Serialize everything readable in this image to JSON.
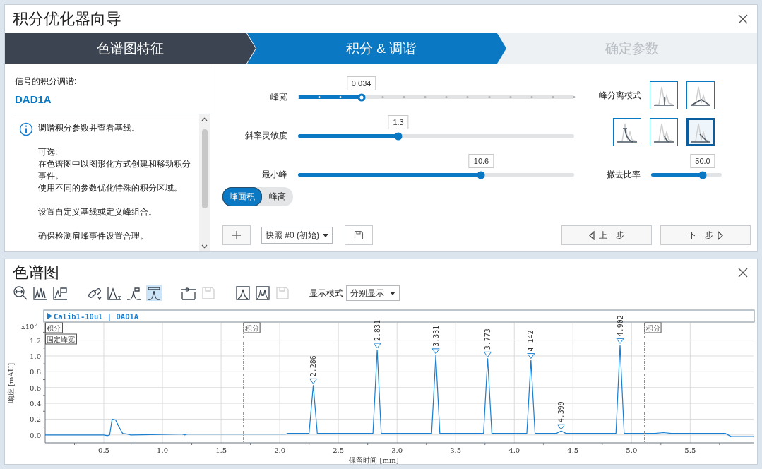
{
  "wizard": {
    "title": "积分优化器向导",
    "steps": [
      {
        "label": "色谱图特征",
        "selected": false,
        "completed": true
      },
      {
        "label": "积分 & 调谐",
        "selected": true,
        "completed": false
      },
      {
        "label": "确定参数",
        "selected": false,
        "completed": false
      }
    ]
  },
  "signal_pane": {
    "heading": "信号的积分调谐:",
    "signal": "DAD1A",
    "info": [
      [
        "调谐积分参数并查看基线。"
      ],
      [
        "可选:",
        "在色谱图中以图形化方式创建和移动积分事件。",
        "使用不同的参数优化特殊的积分区域。"
      ],
      [
        "设置自定义基线或定义峰组合。"
      ],
      [
        "确保检测肩峰事件设置合理。"
      ]
    ]
  },
  "sliders": [
    {
      "label": "峰宽",
      "value": "0.034",
      "level": 0.23,
      "ticks": true
    },
    {
      "label": "斜率灵敏度",
      "value": "1.3",
      "level": 0.364,
      "ticks": false
    },
    {
      "label": "最小峰",
      "value": "10.6",
      "level": 0.664,
      "ticks": false
    }
  ],
  "peak_measure": [
    {
      "label": "峰面积",
      "selected": true
    },
    {
      "label": "峰高",
      "selected": false
    }
  ],
  "separation": {
    "label": "峰分离模式",
    "modes": [
      {
        "kind": "drop",
        "selected": false
      },
      {
        "kind": "valley",
        "selected": false
      },
      {
        "kind": "exp-skim",
        "selected": false
      },
      {
        "kind": "tangent-skim",
        "selected": false
      },
      {
        "kind": "front-skim",
        "selected": true
      }
    ]
  },
  "removal_slider": {
    "label": "撤去比率",
    "value": "50.0",
    "level": 0.73,
    "ticks": false
  },
  "snapshot": {
    "value": "快照 #0 (初始)"
  },
  "nav_buttons": [
    {
      "label": "上一步",
      "kind": "back"
    },
    {
      "label": "下一步",
      "kind": "next"
    }
  ],
  "chromatogram_panel": {
    "title": "色谱图",
    "toolbar": [
      [
        {
          "kind": "zoom",
          "selected": false,
          "disabled": false
        },
        {
          "kind": "peaks",
          "selected": false,
          "disabled": false
        },
        {
          "kind": "step",
          "selected": false,
          "disabled": false
        }
      ],
      [
        {
          "kind": "link",
          "selected": false,
          "disabled": false
        },
        {
          "kind": "peak-axis",
          "selected": false,
          "disabled": false
        },
        {
          "kind": "peak-event",
          "selected": false,
          "disabled": false
        },
        {
          "kind": "peak-box",
          "selected": true,
          "disabled": false
        }
      ],
      [
        {
          "kind": "event-line",
          "selected": false,
          "disabled": false
        },
        {
          "kind": "save",
          "selected": false,
          "disabled": true
        }
      ],
      [
        {
          "kind": "peak-frame",
          "selected": false,
          "disabled": false
        },
        {
          "kind": "peaks-frame",
          "selected": false,
          "disabled": false
        },
        {
          "kind": "save",
          "selected": false,
          "disabled": true
        }
      ]
    ],
    "display_mode": {
      "label": "显示模式",
      "value": "分别显示"
    },
    "y_axis_multiplier": "x10$^{2}$",
    "chart_data": {
      "type": "line",
      "title": "Calib1-10ul | DAD1A",
      "xlabel": "保留时间 [min]",
      "ylabel": "响应 [mAU]",
      "grid": true,
      "xlim": [
        0,
        6.04
      ],
      "ylim": [
        -0.1,
        1.42
      ],
      "xticks": [
        {
          "value": 0.5,
          "label": "0.5"
        },
        {
          "value": 1,
          "label": "1.0"
        },
        {
          "value": 1.5,
          "label": "1.5"
        },
        {
          "value": 2,
          "label": "2.0"
        },
        {
          "value": 2.5,
          "label": "2.5"
        },
        {
          "value": 3,
          "label": "3.0"
        },
        {
          "value": 3.5,
          "label": "3.5"
        },
        {
          "value": 4,
          "label": "4.0"
        },
        {
          "value": 4.5,
          "label": "4.5"
        },
        {
          "value": 5,
          "label": "5.0"
        },
        {
          "value": 5.5,
          "label": "5.5"
        }
      ],
      "yticks": [
        {
          "value": 0,
          "label": "0.0"
        },
        {
          "value": 0.2,
          "label": "0.2"
        },
        {
          "value": 0.4,
          "label": "0.4"
        },
        {
          "value": 0.6,
          "label": "0.6"
        },
        {
          "value": 0.8,
          "label": "0.8"
        },
        {
          "value": 1,
          "label": "1.0"
        },
        {
          "value": 1.2,
          "label": "1.2"
        }
      ],
      "x": [
        0,
        0.5,
        0.53,
        0.55,
        0.57,
        0.6,
        0.63,
        0.66,
        0.7,
        0.73,
        1.17,
        1.19,
        1.21,
        2.05,
        2.07,
        2.25,
        2.286,
        2.32,
        2.795,
        2.831,
        2.865,
        3.295,
        3.331,
        3.365,
        3.738,
        3.773,
        3.808,
        4.107,
        4.142,
        4.177,
        4.36,
        4.399,
        4.44,
        4.867,
        4.902,
        4.937,
        5.2,
        5.27,
        5.34,
        5.8,
        5.85,
        6.04
      ],
      "series": [
        {
          "color": "#1a7fd0",
          "values": [
            0,
            0,
            -0.01,
            0,
            0.2,
            0.19,
            0.1,
            0.02,
            0.01,
            0,
            0.01,
            0,
            0.01,
            0.01,
            0.02,
            0.02,
            0.63,
            0.02,
            0.02,
            1.08,
            0.02,
            0.02,
            1.01,
            0.02,
            0.02,
            0.97,
            0.02,
            0.02,
            0.95,
            0.02,
            0.02,
            0.05,
            0.02,
            0.02,
            1.14,
            0.02,
            0.02,
            0.03,
            0.02,
            0.02,
            -0.02,
            -0.02
          ]
        }
      ],
      "ref_lines": [
        {
          "axis": "x",
          "value": 1.69,
          "label": "积分"
        },
        {
          "axis": "x",
          "value": 5.11,
          "label": "积分"
        }
      ],
      "annotations": [
        "积分",
        "固定峰宽",
        {
          "x": 2.286,
          "y": 0.63,
          "text": "2.286"
        },
        {
          "x": 2.831,
          "y": 1.08,
          "text": "2.831"
        },
        {
          "x": 3.331,
          "y": 1.01,
          "text": "3.331"
        },
        {
          "x": 3.773,
          "y": 0.97,
          "text": "3.773"
        },
        {
          "x": 4.142,
          "y": 0.95,
          "text": "4.142"
        },
        {
          "x": 4.399,
          "y": 0.05,
          "text": "4.399"
        },
        {
          "x": 4.902,
          "y": 1.14,
          "text": "4.902"
        }
      ]
    }
  }
}
